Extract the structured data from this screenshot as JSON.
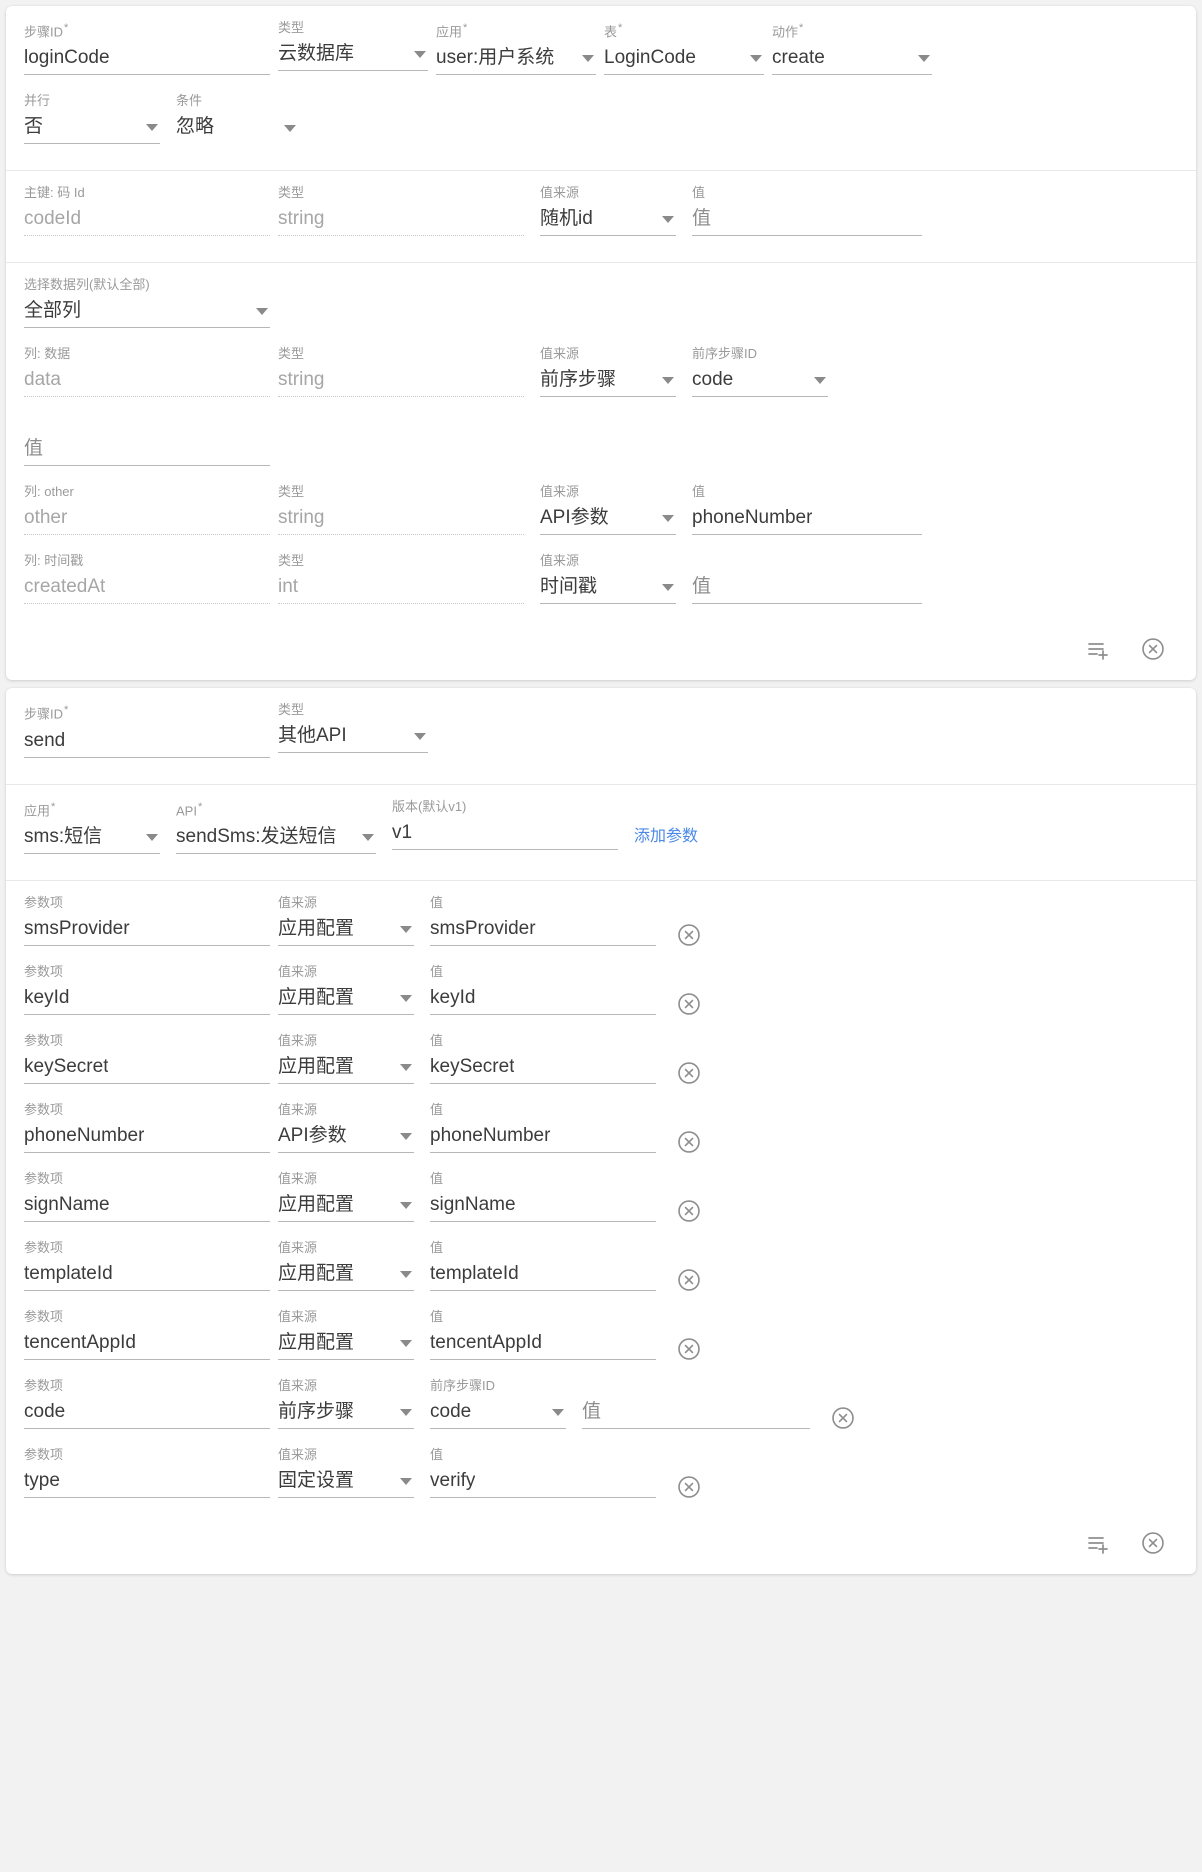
{
  "labels": {
    "step_id": "步骤ID",
    "type": "类型",
    "app": "应用",
    "table": "表",
    "action": "动作",
    "parallel": "并行",
    "condition": "条件",
    "primary_key": "主键: 码 Id",
    "value_source": "值来源",
    "value": "值",
    "select_columns": "选择数据列(默认全部)",
    "col_data": "列: 数据",
    "col_other": "列: other",
    "col_timestamp": "列: 时间戳",
    "prev_step_id": "前序步骤ID",
    "api": "API",
    "version": "版本(默认v1)",
    "param_item": "参数项",
    "required_mark": "*"
  },
  "icons": {
    "caret": "chevron-down-icon",
    "add_row": "playlist-add-icon",
    "remove": "close-circle-icon"
  },
  "colors": {
    "link": "#4a89e8",
    "label": "#9a9a9a",
    "value": "#3c3c3c",
    "muted": "#a6a6a6",
    "underline": "#b7b7b7",
    "card_bg": "#ffffff",
    "page_bg": "#f2f2f2"
  },
  "step1": {
    "header": {
      "step_id_value": "loginCode",
      "type_value": "云数据库",
      "app_value": "user:用户系统",
      "table_value": "LoginCode",
      "action_value": "create",
      "parallel_value": "否",
      "condition_value": "忽略"
    },
    "primary_key_row": {
      "name_value": "codeId",
      "type_value": "string",
      "source_value": "随机id",
      "value_placeholder": "值"
    },
    "select_columns": {
      "value": "全部列"
    },
    "columns": [
      {
        "label": "列: 数据",
        "name_value": "data",
        "type_value": "string",
        "source_value": "前序步骤",
        "extra_label": "前序步骤ID",
        "extra_value": "code",
        "value_placeholder": "值",
        "value_on_new_line": true
      },
      {
        "label": "列: other",
        "name_value": "other",
        "type_value": "string",
        "source_value": "API参数",
        "value_label": "值",
        "value_value": "phoneNumber",
        "value_on_new_line": false
      },
      {
        "label": "列: 时间戳",
        "name_value": "createdAt",
        "type_value": "int",
        "source_value": "时间戳",
        "value_placeholder": "值",
        "value_on_new_line": false
      }
    ]
  },
  "step2": {
    "header": {
      "step_id_value": "send",
      "type_value": "其他API"
    },
    "api_row": {
      "app_value": "sms:短信",
      "api_value": "sendSms:发送短信",
      "version_value": "v1",
      "add_param_label": "添加参数"
    },
    "params": [
      {
        "name": "smsProvider",
        "source": "应用配置",
        "value_label": "值",
        "value": "smsProvider",
        "has_prev_step": false
      },
      {
        "name": "keyId",
        "source": "应用配置",
        "value_label": "值",
        "value": "keyId",
        "has_prev_step": false
      },
      {
        "name": "keySecret",
        "source": "应用配置",
        "value_label": "值",
        "value": "keySecret",
        "has_prev_step": false
      },
      {
        "name": "phoneNumber",
        "source": "API参数",
        "value_label": "值",
        "value": "phoneNumber",
        "has_prev_step": false
      },
      {
        "name": "signName",
        "source": "应用配置",
        "value_label": "值",
        "value": "signName",
        "has_prev_step": false
      },
      {
        "name": "templateId",
        "source": "应用配置",
        "value_label": "值",
        "value": "templateId",
        "has_prev_step": false
      },
      {
        "name": "tencentAppId",
        "source": "应用配置",
        "value_label": "值",
        "value": "tencentAppId",
        "has_prev_step": false
      },
      {
        "name": "code",
        "source": "前序步骤",
        "prev_step_label": "前序步骤ID",
        "prev_step_value": "code",
        "value_label": "值",
        "value_placeholder": "值",
        "has_prev_step": true
      },
      {
        "name": "type",
        "source": "固定设置",
        "value_label": "值",
        "value": "verify",
        "has_prev_step": false
      }
    ]
  }
}
